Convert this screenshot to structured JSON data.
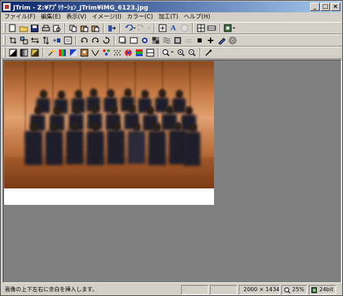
{
  "window": {
    "title": "JTrim - Z:¥ｱﾌﾟﾘｹｰｼｮﾝ_JTrim¥IMG_6123.jpg",
    "controls": {
      "minimize": "_",
      "maximize": "□",
      "close": "×"
    }
  },
  "menu": [
    {
      "label": "ファイル(F)"
    },
    {
      "label": "編集(E)"
    },
    {
      "label": "表示(V)"
    },
    {
      "label": "イメージ(I)"
    },
    {
      "label": "カラー(C)"
    },
    {
      "label": "加工(T)"
    },
    {
      "label": "ヘルプ(H)"
    }
  ],
  "toolbar1": [
    "new-icon",
    "open-icon",
    "save-icon",
    "print-icon",
    "print-preview-icon",
    "copy-icon",
    "paste-icon",
    "paste-new-icon",
    "redo-arrow-icon",
    "undo-icon",
    "redo-icon",
    "fit-window-icon",
    "text-icon",
    "circle-select-icon",
    "grid-icon",
    "ruler-icon",
    "frame-icon"
  ],
  "toolbar2": [
    "crop-icon",
    "resize-icon",
    "flip-h-icon",
    "flip-v-icon",
    "flip-arrows-icon",
    "border-icon",
    "rotate-left-icon",
    "rotate-right-icon",
    "rotate-icon",
    "shadow-icon",
    "frame2-icon",
    "star-icon",
    "mosaic-icon",
    "blur-icon",
    "noise-icon",
    "sharpen-icon",
    "bold-icon",
    "pen-icon",
    "pencil-icon",
    "spiral-icon"
  ],
  "toolbar3": [
    "fill-icon",
    "gradient-icon",
    "levels-icon",
    "wand-icon",
    "color-icon",
    "picture-icon",
    "gamma-icon",
    "hue-icon",
    "dots-icon",
    "sepia-icon",
    "mono-icon",
    "rgb-icon",
    "zoom-menu-icon",
    "zoom-in-icon",
    "zoom-out-icon",
    "eyedropper-icon"
  ],
  "status": {
    "message": "画像の上下左右に余白を挿入します。",
    "dimensions": "2000 × 1434",
    "zoom": "25%",
    "bitdepth": "24bit"
  }
}
